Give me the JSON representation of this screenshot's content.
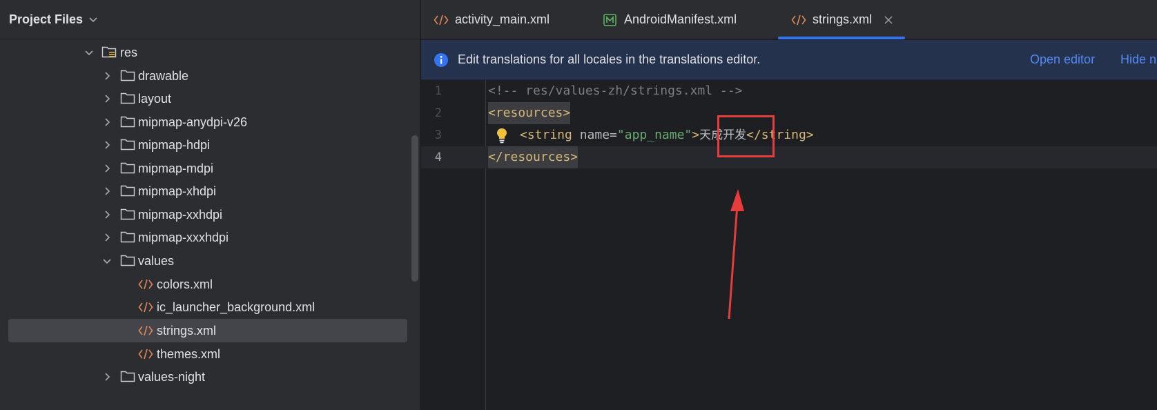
{
  "sidebar": {
    "title": "Project Files",
    "tree": [
      {
        "label": "res",
        "icon": "res-folder-icon",
        "expanded": true,
        "level": 0
      },
      {
        "label": "drawable",
        "icon": "folder-icon",
        "expanded": false,
        "level": 1
      },
      {
        "label": "layout",
        "icon": "folder-icon",
        "expanded": false,
        "level": 1
      },
      {
        "label": "mipmap-anydpi-v26",
        "icon": "folder-icon",
        "expanded": false,
        "level": 1
      },
      {
        "label": "mipmap-hdpi",
        "icon": "folder-icon",
        "expanded": false,
        "level": 1
      },
      {
        "label": "mipmap-mdpi",
        "icon": "folder-icon",
        "expanded": false,
        "level": 1
      },
      {
        "label": "mipmap-xhdpi",
        "icon": "folder-icon",
        "expanded": false,
        "level": 1
      },
      {
        "label": "mipmap-xxhdpi",
        "icon": "folder-icon",
        "expanded": false,
        "level": 1
      },
      {
        "label": "mipmap-xxxhdpi",
        "icon": "folder-icon",
        "expanded": false,
        "level": 1
      },
      {
        "label": "values",
        "icon": "folder-icon",
        "expanded": true,
        "level": 1
      },
      {
        "label": "colors.xml",
        "icon": "xml-file-icon",
        "level": 2
      },
      {
        "label": "ic_launcher_background.xml",
        "icon": "xml-file-icon",
        "level": 2
      },
      {
        "label": "strings.xml",
        "icon": "xml-file-icon",
        "level": 2,
        "selected": true
      },
      {
        "label": "themes.xml",
        "icon": "xml-file-icon",
        "level": 2
      },
      {
        "label": "values-night",
        "icon": "folder-icon",
        "expanded": false,
        "level": 1
      }
    ]
  },
  "tabs": [
    {
      "label": "activity_main.xml",
      "icon": "xml-file-icon"
    },
    {
      "label": "AndroidManifest.xml",
      "icon": "manifest-icon"
    },
    {
      "label": "strings.xml",
      "icon": "xml-file-icon",
      "active": true
    }
  ],
  "banner": {
    "text": "Edit translations for all locales in the translations editor.",
    "open_editor": "Open editor",
    "hide": "Hide n"
  },
  "editor": {
    "lines": [
      {
        "no": "1",
        "comment": "<!-- res/values-zh/strings.xml -->"
      },
      {
        "no": "2",
        "open_tag": "<resources>"
      },
      {
        "no": "3",
        "tag_start": "<string",
        "attr": " name=",
        "value": "\"app_name\"",
        "tag_mid": ">",
        "text": "天成开发",
        "tag_end": "</string>"
      },
      {
        "no": "4",
        "close_tag": "</resources>"
      }
    ]
  },
  "colors": {
    "accent": "#3574f0",
    "link": "#548af7",
    "annotation": "#e53c3c",
    "xml_tag": "#d5b778",
    "xml_value": "#6aab73"
  }
}
